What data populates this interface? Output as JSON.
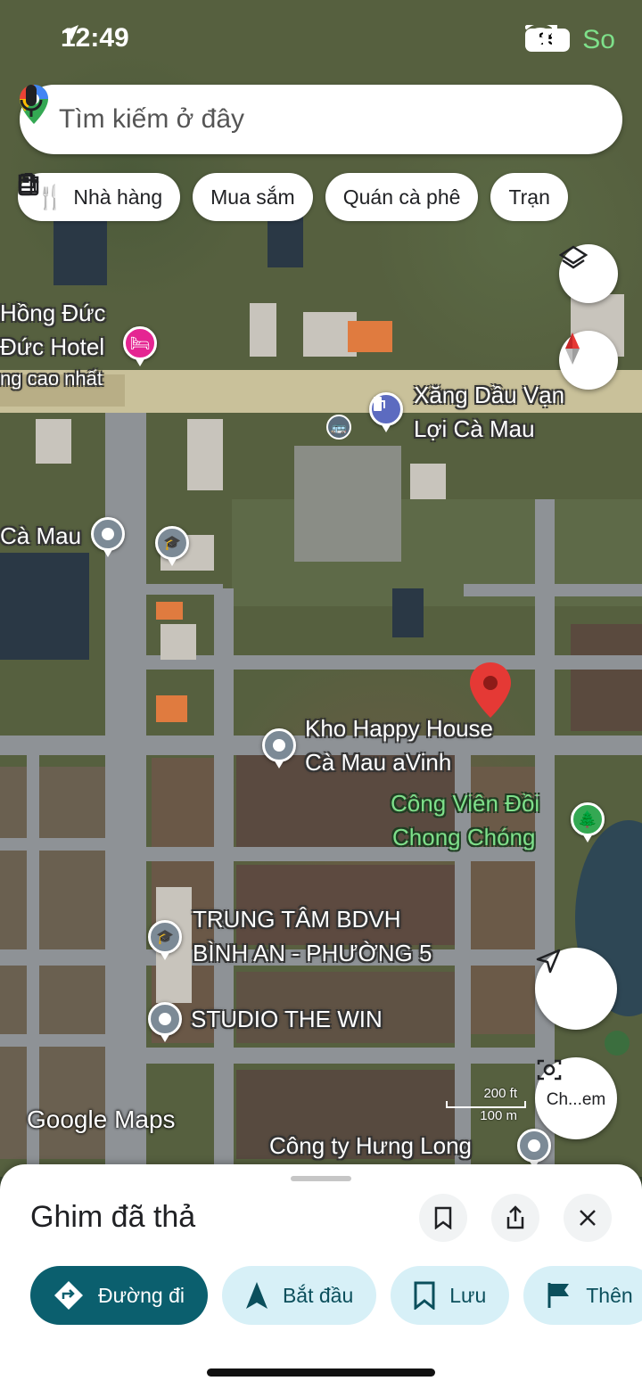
{
  "status_bar": {
    "time": "12:49",
    "battery": "85",
    "corner_text": "So"
  },
  "search": {
    "placeholder": "Tìm kiếm ở đây"
  },
  "chips": [
    {
      "label": "Nhà hàng",
      "icon": "fork-knife-icon"
    },
    {
      "label": "Mua sắm",
      "icon": "shopping-bag-icon"
    },
    {
      "label": "Quán cà phê",
      "icon": "coffee-cup-icon"
    },
    {
      "label": "Trạn",
      "icon": "gas-station-icon"
    }
  ],
  "map": {
    "labels": {
      "hong_duc": "Hồng Đức",
      "duc_hotel": "Đức Hotel",
      "cao_nhat": "ng cao nhất",
      "xang_dau": "Xăng Dầu Vạn",
      "loi_ca_mau": "Lợi Cà Mau",
      "ca_mau": "Cà Mau",
      "kho_happy": "Kho Happy House",
      "kho_happy_2": "Cà Mau aVinh",
      "cong_vien": "Công Viên Đồi",
      "cong_vien_2": "Chong Chóng",
      "trung_tam": "TRUNG TÂM BDVH",
      "trung_tam_2": "BÌNH AN - PHƯỜNG 5",
      "studio": "STUDIO THE WIN",
      "hung_long": "Công ty Hưng Long"
    },
    "brand": "Google Maps",
    "scale_ft": "200 ft",
    "scale_m": "100 m",
    "camera_label": "Ch...em",
    "colors": {
      "pin": "#e53935",
      "poi_gray": "#7c8a96",
      "hotel": "#e52592",
      "fuel": "#5c6bc0",
      "park": "#34a853"
    }
  },
  "sheet": {
    "title": "Ghim đã thả",
    "actions": [
      {
        "label": "Đường đi",
        "icon": "directions-icon"
      },
      {
        "label": "Bắt đầu",
        "icon": "navigation-arrow-icon"
      },
      {
        "label": "Lưu",
        "icon": "bookmark-icon"
      },
      {
        "label": "Thên",
        "icon": "flag-icon"
      }
    ]
  }
}
